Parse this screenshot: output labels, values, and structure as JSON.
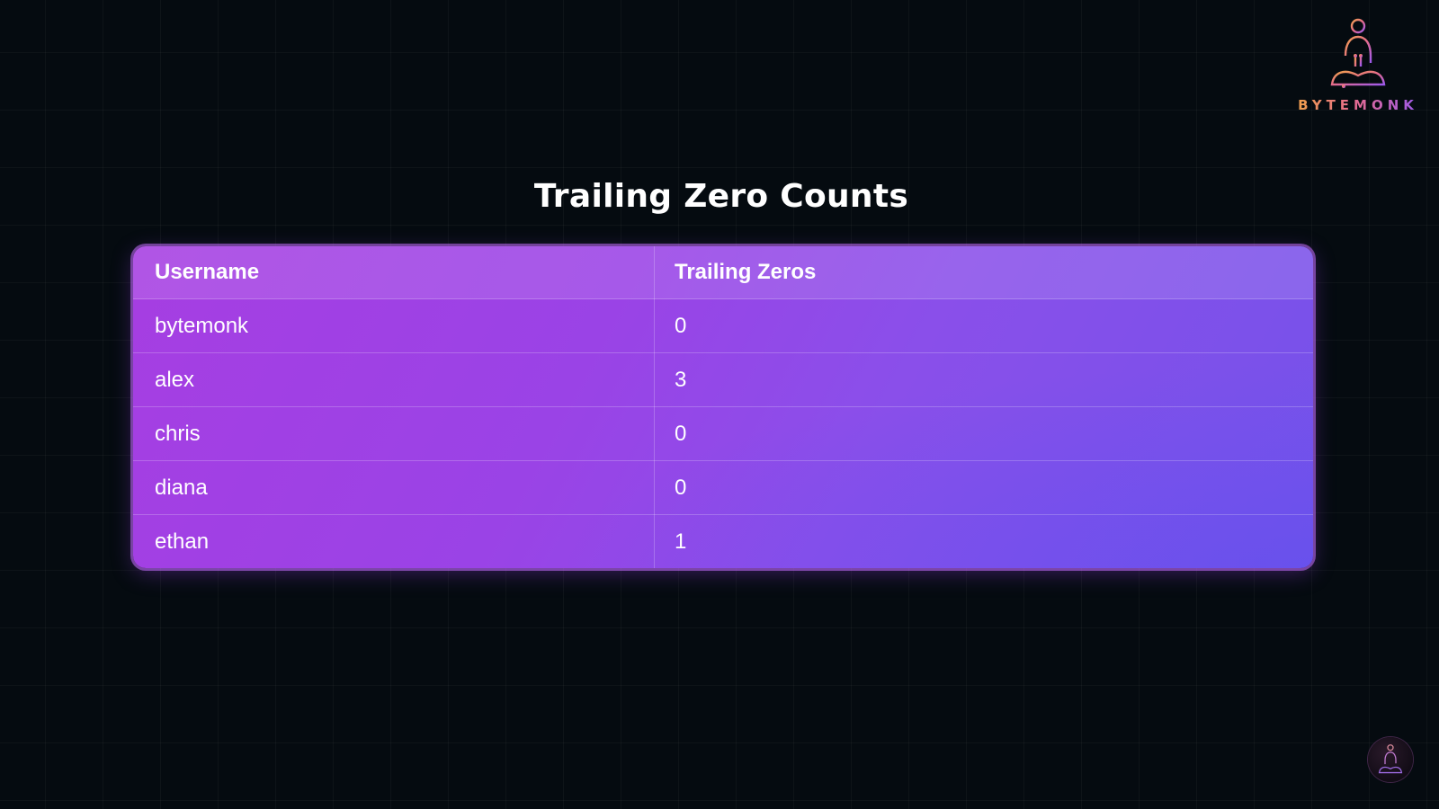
{
  "brand": {
    "logo_text": "BYTEMONK",
    "logo_icon": "meditating-monk-icon",
    "colors": {
      "orange": "#f0a24a",
      "pink": "#e66c8c",
      "purple": "#9c59ee"
    }
  },
  "title": "Trailing Zero Counts",
  "table": {
    "headers": [
      "Username",
      "Trailing Zeros"
    ],
    "rows": [
      {
        "username": "bytemonk",
        "trailing_zeros": "0"
      },
      {
        "username": "alex",
        "trailing_zeros": "3"
      },
      {
        "username": "chris",
        "trailing_zeros": "0"
      },
      {
        "username": "diana",
        "trailing_zeros": "0"
      },
      {
        "username": "ethan",
        "trailing_zeros": "1"
      }
    ]
  },
  "corner_badge": {
    "icon": "monk-avatar-icon"
  },
  "theme": {
    "background": "#050b10",
    "table_start": "#a63ee2",
    "table_end": "#7452ea"
  }
}
